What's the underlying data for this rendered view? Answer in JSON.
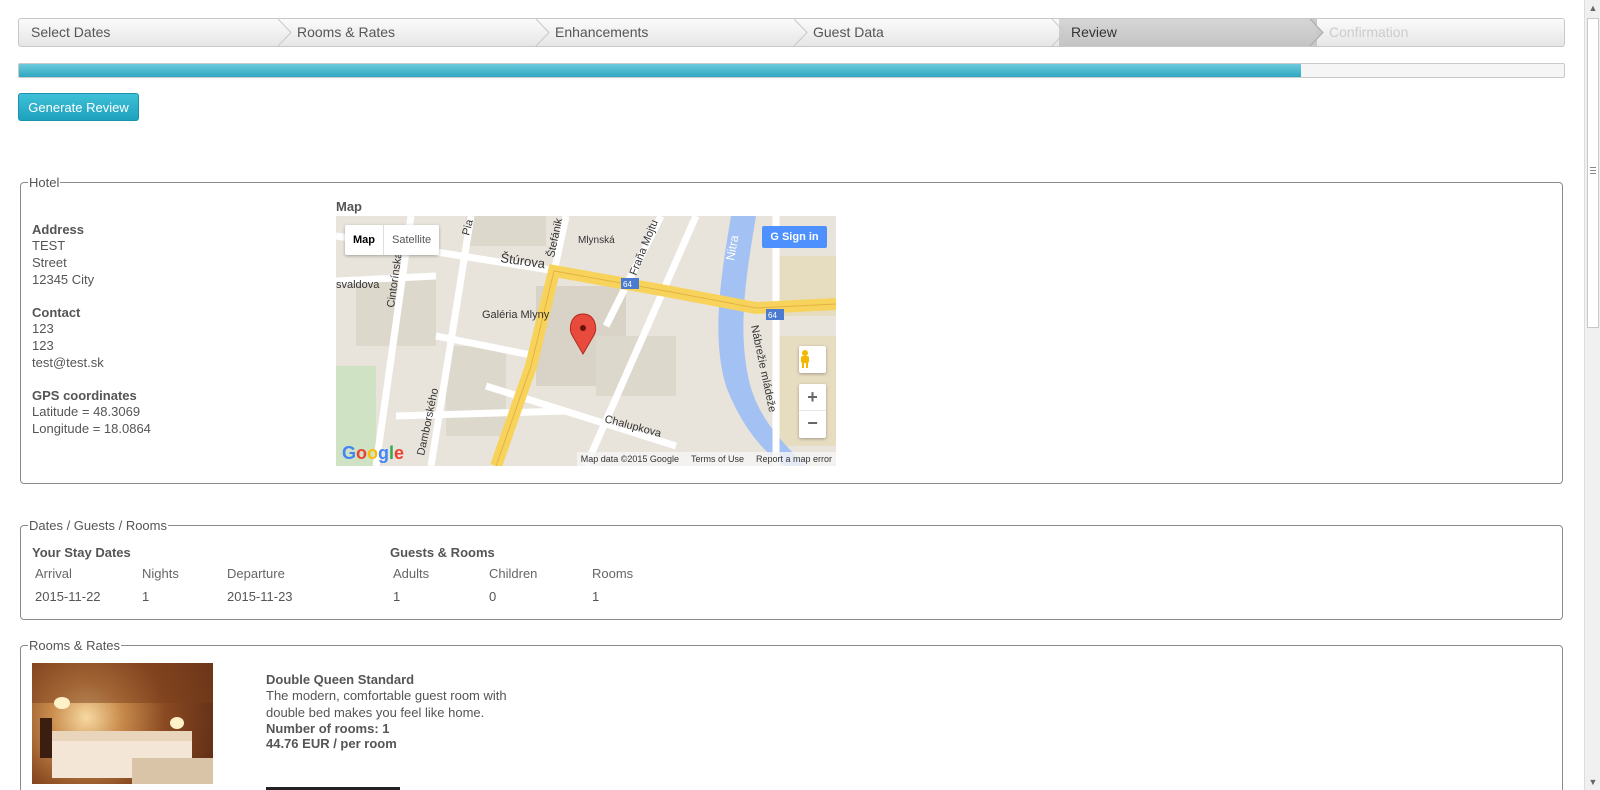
{
  "wizard": {
    "steps": [
      {
        "label": "Select Dates"
      },
      {
        "label": "Rooms & Rates"
      },
      {
        "label": "Enhancements"
      },
      {
        "label": "Guest Data"
      },
      {
        "label": "Review"
      },
      {
        "label": "Confirmation"
      }
    ],
    "progress_fraction": 0.83
  },
  "generate_button": "Generate Review",
  "hotel": {
    "legend": "Hotel",
    "address_label": "Address",
    "address_lines": [
      "TEST",
      "Street",
      "12345 City"
    ],
    "contact_label": "Contact",
    "contact_lines": [
      "123",
      "123",
      "test@test.sk"
    ],
    "gps_label": "GPS coordinates",
    "latitude": "Latitude = 48.3069",
    "longitude": "Longitude = 18.0864",
    "map_label": "Map",
    "map": {
      "type_map": "Map",
      "type_satellite": "Satellite",
      "signin": "Sign in",
      "zoom_in": "+",
      "zoom_out": "−",
      "logo": "Google",
      "footer": [
        "Map data ©2015 Google",
        "Terms of Use",
        "Report a map error"
      ],
      "streets": [
        "Štúrova",
        "Mlynská",
        "Fraňa Mojtu",
        "Nitra",
        "Cintorínska",
        "Galéria Mlyny",
        "Damborského",
        "Chalupkova",
        "Nábrežie mládeže",
        "svaldova",
        "Štefánik",
        "Pia",
        "64",
        "64"
      ]
    }
  },
  "dates_guests": {
    "legend": "Dates / Guests / Rooms",
    "stay_label": "Your Stay Dates",
    "stay_headers": [
      "Arrival",
      "Nights",
      "Departure"
    ],
    "stay_values": [
      "2015-11-22",
      "1",
      "2015-11-23"
    ],
    "guests_label": "Guests & Rooms",
    "guests_headers": [
      "Adults",
      "Children",
      "Rooms"
    ],
    "guests_values": [
      "1",
      "0",
      "1"
    ]
  },
  "rooms_rates": {
    "legend": "Rooms & Rates",
    "room_name": "Double Queen Standard",
    "room_desc": "The modern, comfortable guest room with double bed makes you feel like home.",
    "rooms_count": "Number of rooms: 1",
    "price": "44.76 EUR / per room"
  },
  "colors": {
    "accent": "#2fa7c1",
    "border": "#8a8a8a"
  }
}
